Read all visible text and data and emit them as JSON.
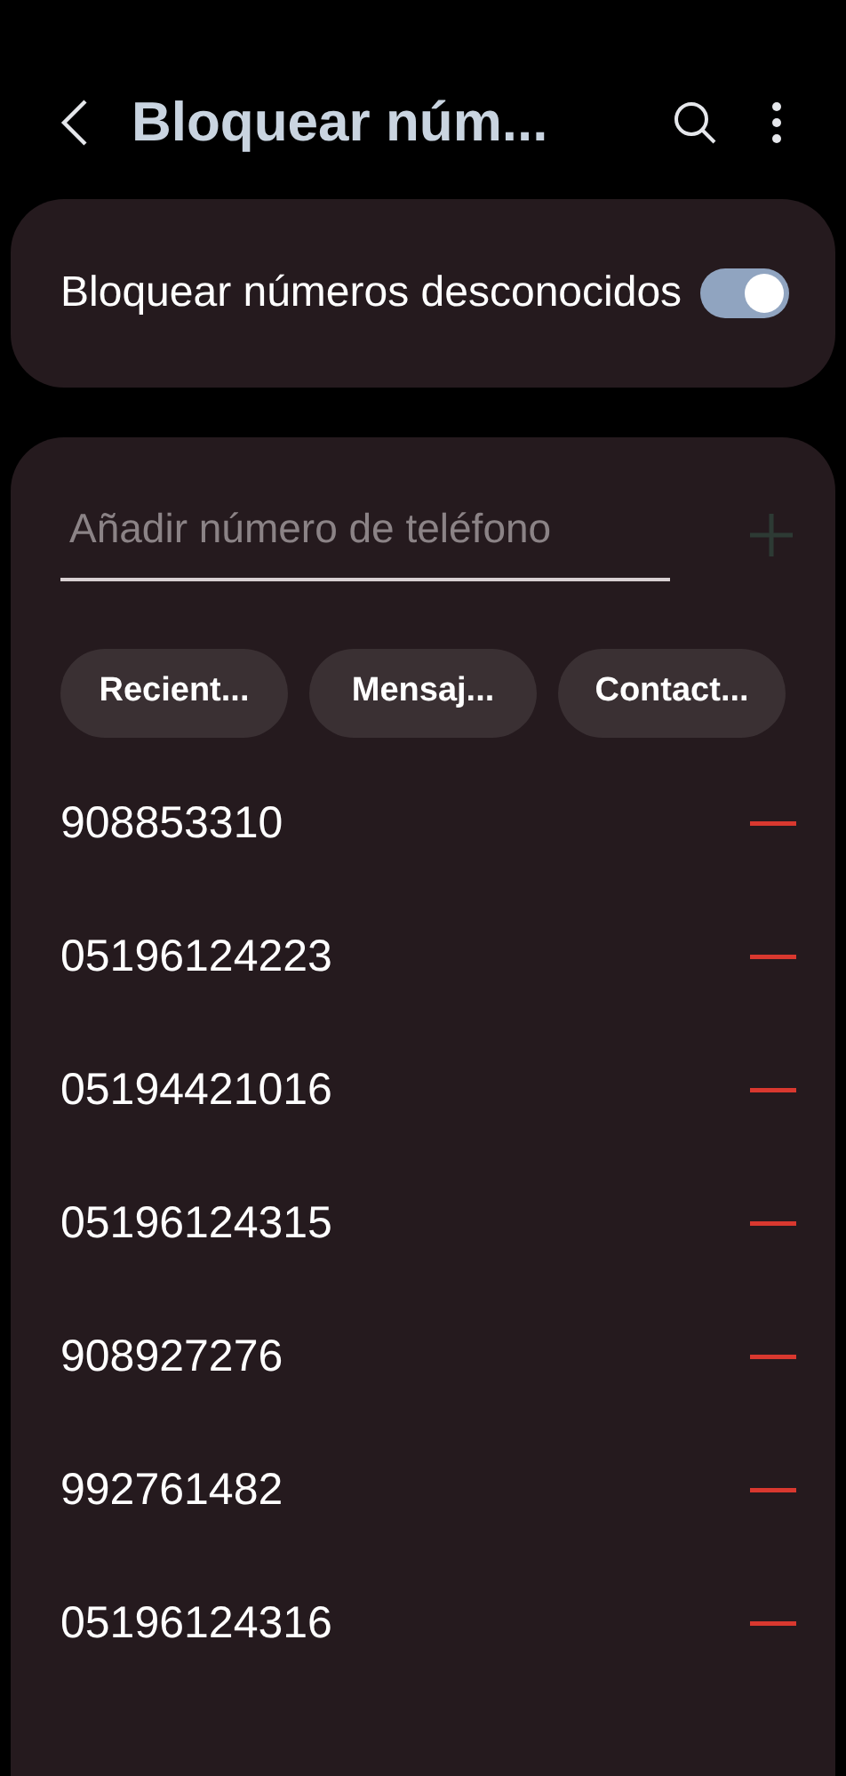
{
  "header": {
    "title": "Bloquear núm..."
  },
  "block_unknown": {
    "label": "Bloquear números desconocidos",
    "on": true
  },
  "add_field": {
    "placeholder": "Añadir número de teléfono"
  },
  "sources": [
    "Recient...",
    "Mensaj...",
    "Contact..."
  ],
  "blocked_numbers": [
    "908853310",
    "05196124223",
    "05194421016",
    "05196124315",
    "908927276",
    "992761482",
    "05196124316"
  ]
}
